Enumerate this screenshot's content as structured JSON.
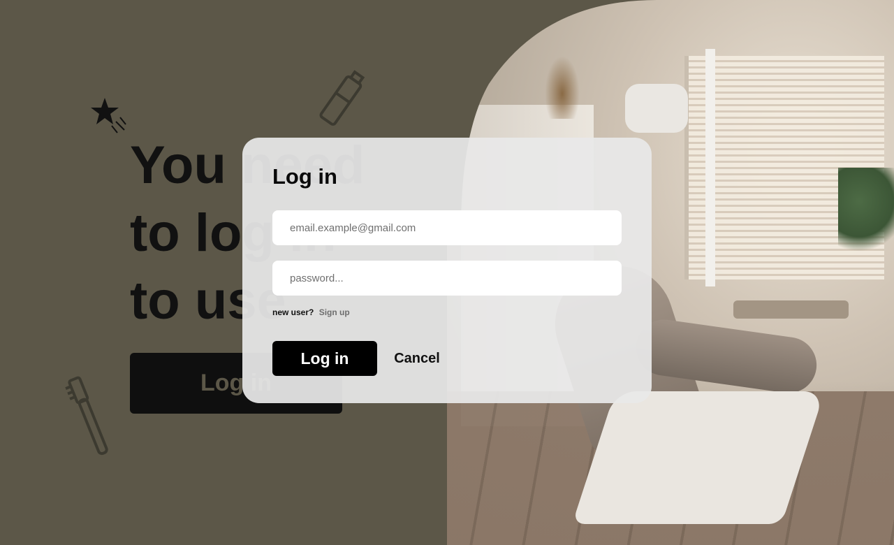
{
  "background": {
    "heading_lines": [
      "You need",
      "to log in",
      "to use"
    ],
    "login_button_label": "Log in",
    "bg_color": "#5c5748"
  },
  "modal": {
    "title": "Log in",
    "email_placeholder": "email.example@gmail.com",
    "password_placeholder": "password...",
    "new_user_text": "new user?",
    "signup_link": "Sign up",
    "login_button_label": "Log in",
    "cancel_button_label": "Cancel"
  },
  "icons": {
    "star": "star-icon",
    "toothpaste": "toothpaste-icon",
    "toothbrush": "toothbrush-icon"
  }
}
